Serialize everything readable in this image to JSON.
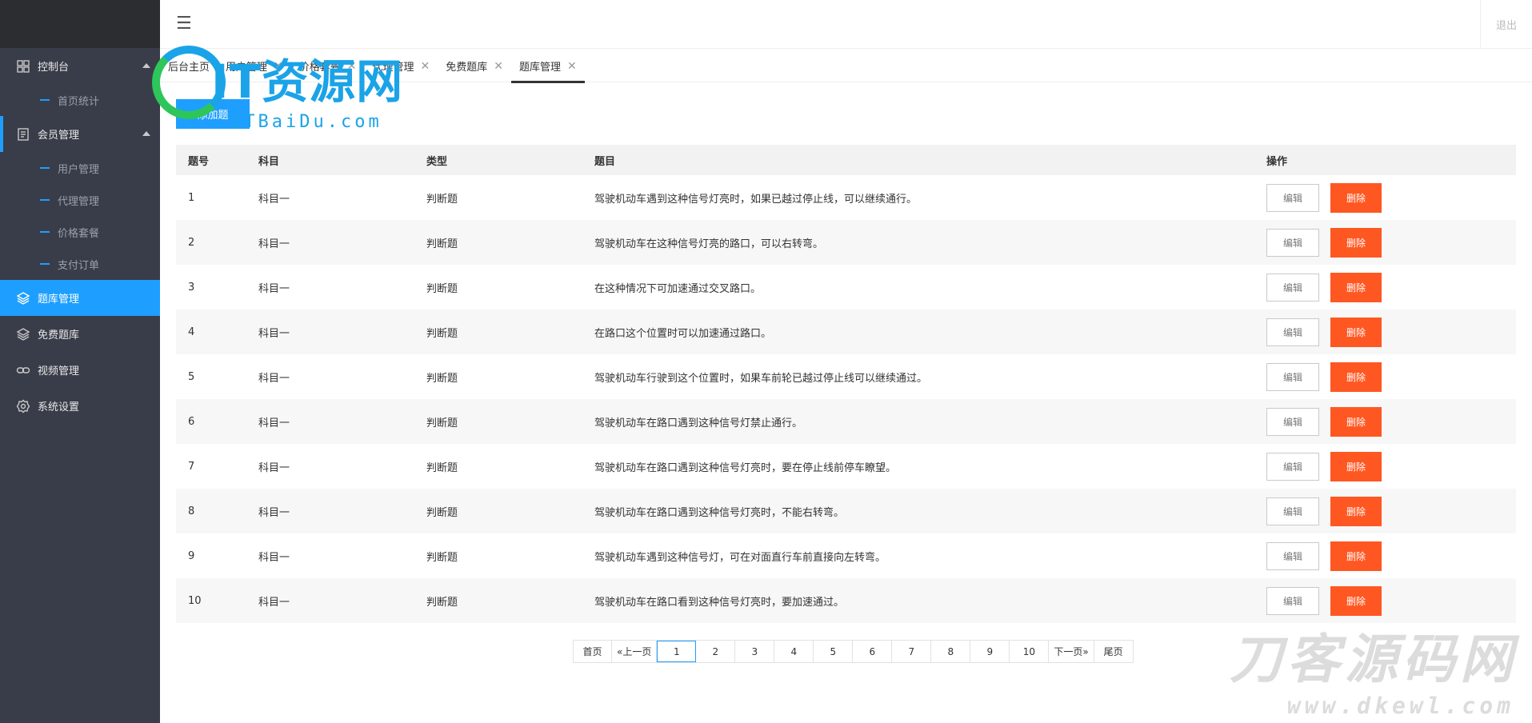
{
  "sidebar": {
    "groups": [
      {
        "label": "控制台",
        "icon": "dashboard-icon",
        "expanded": true,
        "children": [
          "首页统计"
        ]
      },
      {
        "label": "会员管理",
        "icon": "document-icon",
        "expanded": true,
        "children": [
          "用户管理",
          "代理管理",
          "价格套餐",
          "支付订单"
        ]
      },
      {
        "label": "题库管理",
        "icon": "layers-icon",
        "active": true
      },
      {
        "label": "免费题库",
        "icon": "layers-icon"
      },
      {
        "label": "视频管理",
        "icon": "link-icon"
      },
      {
        "label": "系统设置",
        "icon": "gear-icon"
      }
    ]
  },
  "header": {
    "menu_icon": "hamburger-icon",
    "logout_label": "退出"
  },
  "tabs": [
    {
      "label": "后台主页",
      "closable": false
    },
    {
      "label": "用户管理",
      "closable": true
    },
    {
      "label": "价格套餐",
      "closable": true
    },
    {
      "label": "代理管理",
      "closable": true
    },
    {
      "label": "免费题库",
      "closable": true
    },
    {
      "label": "题库管理",
      "closable": true,
      "active": true
    }
  ],
  "toolbar": {
    "add_label": "添加题"
  },
  "table": {
    "headers": [
      "题号",
      "科目",
      "类型",
      "题目",
      "操作"
    ],
    "edit_label": "编辑",
    "delete_label": "删除",
    "rows": [
      {
        "id": "1",
        "subject": "科目一",
        "type": "判断题",
        "question": "驾驶机动车遇到这种信号灯亮时，如果已越过停止线，可以继续通行。"
      },
      {
        "id": "2",
        "subject": "科目一",
        "type": "判断题",
        "question": "驾驶机动车在这种信号灯亮的路口，可以右转弯。"
      },
      {
        "id": "3",
        "subject": "科目一",
        "type": "判断题",
        "question": "在这种情况下可加速通过交叉路口。"
      },
      {
        "id": "4",
        "subject": "科目一",
        "type": "判断题",
        "question": "在路口这个位置时可以加速通过路口。"
      },
      {
        "id": "5",
        "subject": "科目一",
        "type": "判断题",
        "question": "驾驶机动车行驶到这个位置时，如果车前轮已越过停止线可以继续通过。"
      },
      {
        "id": "6",
        "subject": "科目一",
        "type": "判断题",
        "question": "驾驶机动车在路口遇到这种信号灯禁止通行。"
      },
      {
        "id": "7",
        "subject": "科目一",
        "type": "判断题",
        "question": "驾驶机动车在路口遇到这种信号灯亮时，要在停止线前停车瞭望。"
      },
      {
        "id": "8",
        "subject": "科目一",
        "type": "判断题",
        "question": "驾驶机动车在路口遇到这种信号灯亮时，不能右转弯。"
      },
      {
        "id": "9",
        "subject": "科目一",
        "type": "判断题",
        "question": "驾驶机动车遇到这种信号灯，可在对面直行车前直接向左转弯。"
      },
      {
        "id": "10",
        "subject": "科目一",
        "type": "判断题",
        "question": "驾驶机动车在路口看到这种信号灯亮时，要加速通过。"
      }
    ]
  },
  "pagination": {
    "first": "首页",
    "prev": "«上一页",
    "pages": [
      "1",
      "2",
      "3",
      "4",
      "5",
      "6",
      "7",
      "8",
      "9",
      "10"
    ],
    "current": "1",
    "next": "下一页»",
    "last": "尾页"
  },
  "watermarks": {
    "logo_text": "IT资源网",
    "logo_sub": "ITBaiDu.com",
    "footer_text": "刀客源码网",
    "footer_sub": "www.dkewl.com"
  },
  "colors": {
    "sidebar_bg": "#393d49",
    "accent": "#1e9fff",
    "danger": "#ff5722"
  }
}
